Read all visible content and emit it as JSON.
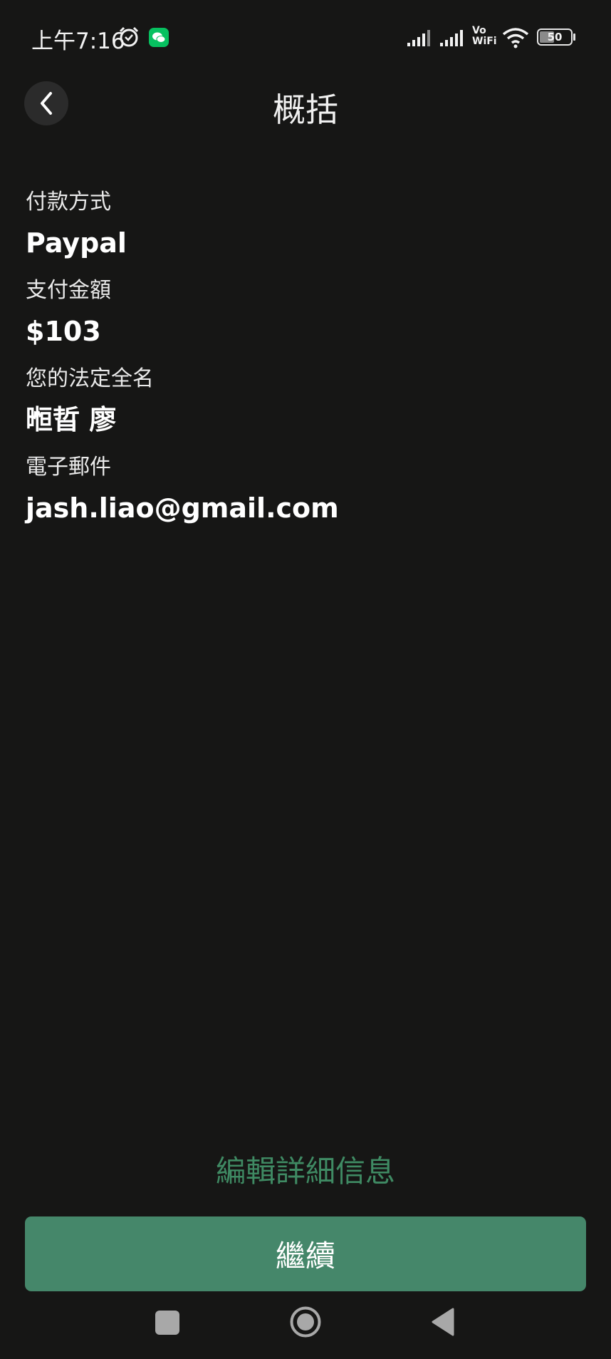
{
  "status_bar": {
    "time": "上午7:16",
    "battery_level": "50",
    "vowifi_top": "Vo",
    "vowifi_bottom": "WiFi"
  },
  "header": {
    "title": "概括"
  },
  "summary": {
    "payment_method_label": "付款方式",
    "payment_method_value": "Paypal",
    "amount_label": "支付金額",
    "amount_value": "$103",
    "legal_name_label": "您的法定全名",
    "legal_name_value": "暅晢 廖",
    "email_label": "電子郵件",
    "email_value": "jash.liao@gmail.com"
  },
  "actions": {
    "edit_details_label": "編輯詳細信息",
    "continue_label": "繼續"
  },
  "colors": {
    "background": "#161615",
    "accent_green": "#45876a",
    "link_green": "#3f8a63"
  }
}
